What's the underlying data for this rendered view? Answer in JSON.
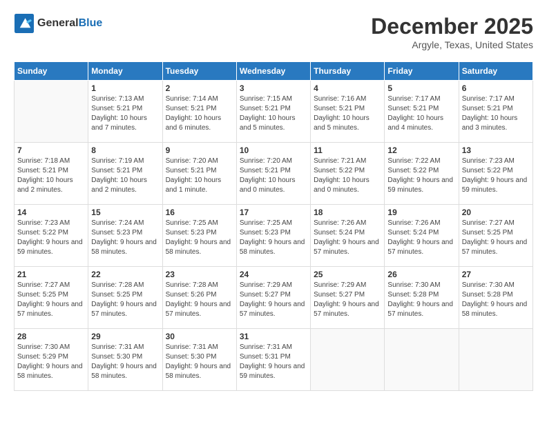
{
  "header": {
    "logo_line1": "General",
    "logo_line2": "Blue",
    "month": "December 2025",
    "location": "Argyle, Texas, United States"
  },
  "weekdays": [
    "Sunday",
    "Monday",
    "Tuesday",
    "Wednesday",
    "Thursday",
    "Friday",
    "Saturday"
  ],
  "weeks": [
    [
      {
        "day": "",
        "empty": true
      },
      {
        "day": "1",
        "sunrise": "Sunrise: 7:13 AM",
        "sunset": "Sunset: 5:21 PM",
        "daylight": "Daylight: 10 hours and 7 minutes."
      },
      {
        "day": "2",
        "sunrise": "Sunrise: 7:14 AM",
        "sunset": "Sunset: 5:21 PM",
        "daylight": "Daylight: 10 hours and 6 minutes."
      },
      {
        "day": "3",
        "sunrise": "Sunrise: 7:15 AM",
        "sunset": "Sunset: 5:21 PM",
        "daylight": "Daylight: 10 hours and 5 minutes."
      },
      {
        "day": "4",
        "sunrise": "Sunrise: 7:16 AM",
        "sunset": "Sunset: 5:21 PM",
        "daylight": "Daylight: 10 hours and 5 minutes."
      },
      {
        "day": "5",
        "sunrise": "Sunrise: 7:17 AM",
        "sunset": "Sunset: 5:21 PM",
        "daylight": "Daylight: 10 hours and 4 minutes."
      },
      {
        "day": "6",
        "sunrise": "Sunrise: 7:17 AM",
        "sunset": "Sunset: 5:21 PM",
        "daylight": "Daylight: 10 hours and 3 minutes."
      }
    ],
    [
      {
        "day": "7",
        "sunrise": "Sunrise: 7:18 AM",
        "sunset": "Sunset: 5:21 PM",
        "daylight": "Daylight: 10 hours and 2 minutes."
      },
      {
        "day": "8",
        "sunrise": "Sunrise: 7:19 AM",
        "sunset": "Sunset: 5:21 PM",
        "daylight": "Daylight: 10 hours and 2 minutes."
      },
      {
        "day": "9",
        "sunrise": "Sunrise: 7:20 AM",
        "sunset": "Sunset: 5:21 PM",
        "daylight": "Daylight: 10 hours and 1 minute."
      },
      {
        "day": "10",
        "sunrise": "Sunrise: 7:20 AM",
        "sunset": "Sunset: 5:21 PM",
        "daylight": "Daylight: 10 hours and 0 minutes."
      },
      {
        "day": "11",
        "sunrise": "Sunrise: 7:21 AM",
        "sunset": "Sunset: 5:22 PM",
        "daylight": "Daylight: 10 hours and 0 minutes."
      },
      {
        "day": "12",
        "sunrise": "Sunrise: 7:22 AM",
        "sunset": "Sunset: 5:22 PM",
        "daylight": "Daylight: 9 hours and 59 minutes."
      },
      {
        "day": "13",
        "sunrise": "Sunrise: 7:23 AM",
        "sunset": "Sunset: 5:22 PM",
        "daylight": "Daylight: 9 hours and 59 minutes."
      }
    ],
    [
      {
        "day": "14",
        "sunrise": "Sunrise: 7:23 AM",
        "sunset": "Sunset: 5:22 PM",
        "daylight": "Daylight: 9 hours and 59 minutes."
      },
      {
        "day": "15",
        "sunrise": "Sunrise: 7:24 AM",
        "sunset": "Sunset: 5:23 PM",
        "daylight": "Daylight: 9 hours and 58 minutes."
      },
      {
        "day": "16",
        "sunrise": "Sunrise: 7:25 AM",
        "sunset": "Sunset: 5:23 PM",
        "daylight": "Daylight: 9 hours and 58 minutes."
      },
      {
        "day": "17",
        "sunrise": "Sunrise: 7:25 AM",
        "sunset": "Sunset: 5:23 PM",
        "daylight": "Daylight: 9 hours and 58 minutes."
      },
      {
        "day": "18",
        "sunrise": "Sunrise: 7:26 AM",
        "sunset": "Sunset: 5:24 PM",
        "daylight": "Daylight: 9 hours and 57 minutes."
      },
      {
        "day": "19",
        "sunrise": "Sunrise: 7:26 AM",
        "sunset": "Sunset: 5:24 PM",
        "daylight": "Daylight: 9 hours and 57 minutes."
      },
      {
        "day": "20",
        "sunrise": "Sunrise: 7:27 AM",
        "sunset": "Sunset: 5:25 PM",
        "daylight": "Daylight: 9 hours and 57 minutes."
      }
    ],
    [
      {
        "day": "21",
        "sunrise": "Sunrise: 7:27 AM",
        "sunset": "Sunset: 5:25 PM",
        "daylight": "Daylight: 9 hours and 57 minutes."
      },
      {
        "day": "22",
        "sunrise": "Sunrise: 7:28 AM",
        "sunset": "Sunset: 5:25 PM",
        "daylight": "Daylight: 9 hours and 57 minutes."
      },
      {
        "day": "23",
        "sunrise": "Sunrise: 7:28 AM",
        "sunset": "Sunset: 5:26 PM",
        "daylight": "Daylight: 9 hours and 57 minutes."
      },
      {
        "day": "24",
        "sunrise": "Sunrise: 7:29 AM",
        "sunset": "Sunset: 5:27 PM",
        "daylight": "Daylight: 9 hours and 57 minutes."
      },
      {
        "day": "25",
        "sunrise": "Sunrise: 7:29 AM",
        "sunset": "Sunset: 5:27 PM",
        "daylight": "Daylight: 9 hours and 57 minutes."
      },
      {
        "day": "26",
        "sunrise": "Sunrise: 7:30 AM",
        "sunset": "Sunset: 5:28 PM",
        "daylight": "Daylight: 9 hours and 57 minutes."
      },
      {
        "day": "27",
        "sunrise": "Sunrise: 7:30 AM",
        "sunset": "Sunset: 5:28 PM",
        "daylight": "Daylight: 9 hours and 58 minutes."
      }
    ],
    [
      {
        "day": "28",
        "sunrise": "Sunrise: 7:30 AM",
        "sunset": "Sunset: 5:29 PM",
        "daylight": "Daylight: 9 hours and 58 minutes."
      },
      {
        "day": "29",
        "sunrise": "Sunrise: 7:31 AM",
        "sunset": "Sunset: 5:30 PM",
        "daylight": "Daylight: 9 hours and 58 minutes."
      },
      {
        "day": "30",
        "sunrise": "Sunrise: 7:31 AM",
        "sunset": "Sunset: 5:30 PM",
        "daylight": "Daylight: 9 hours and 58 minutes."
      },
      {
        "day": "31",
        "sunrise": "Sunrise: 7:31 AM",
        "sunset": "Sunset: 5:31 PM",
        "daylight": "Daylight: 9 hours and 59 minutes."
      },
      {
        "day": "",
        "empty": true
      },
      {
        "day": "",
        "empty": true
      },
      {
        "day": "",
        "empty": true
      }
    ]
  ]
}
